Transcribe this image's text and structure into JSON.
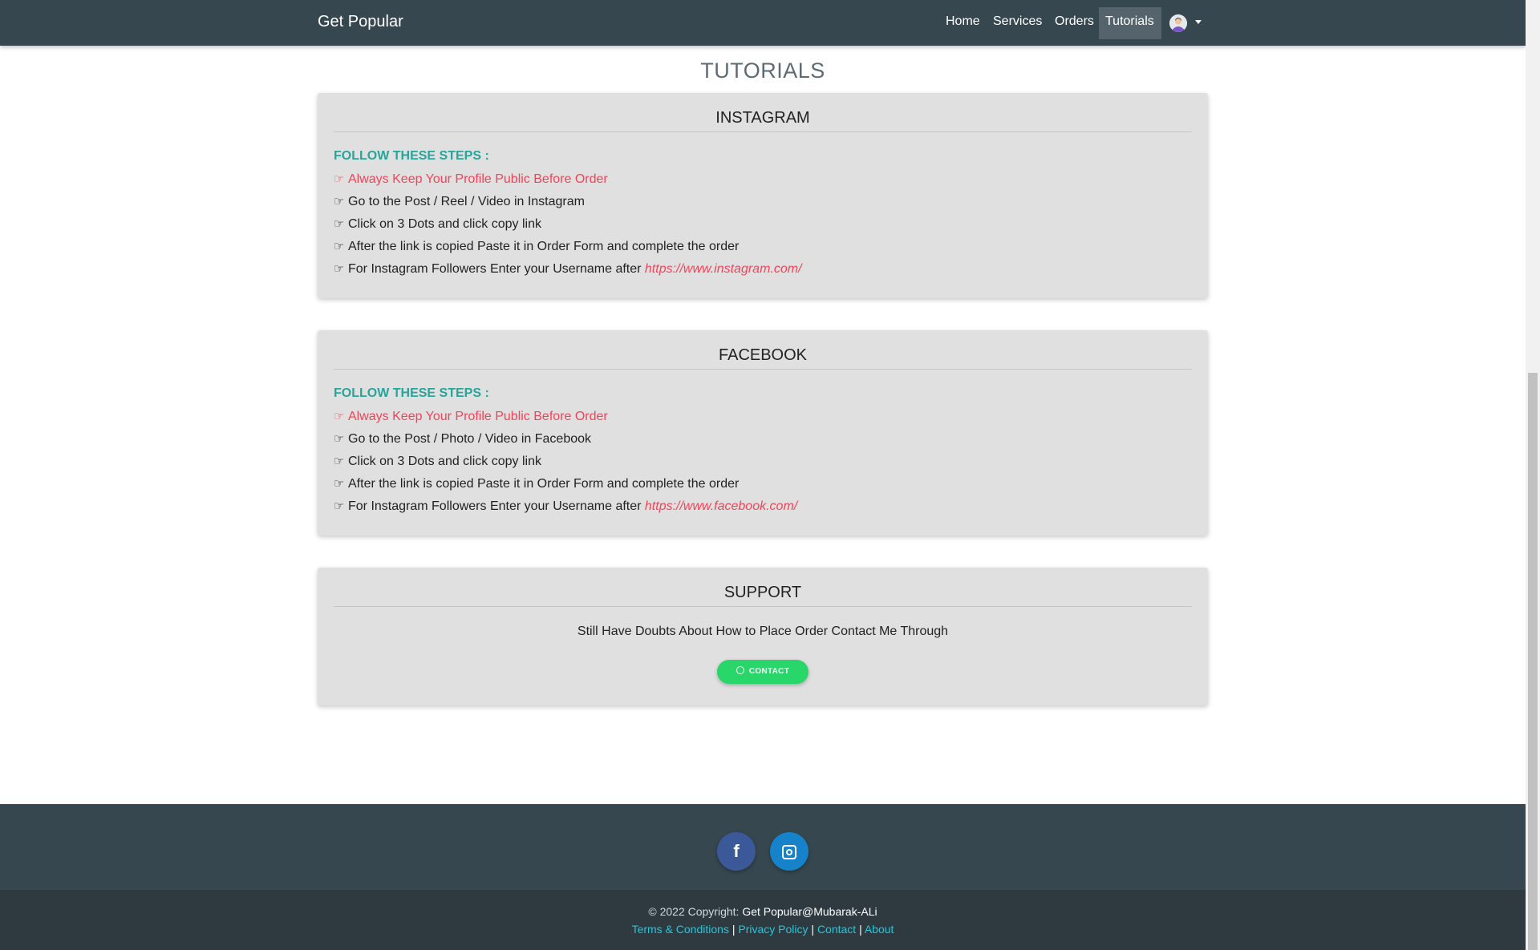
{
  "navbar": {
    "brand": "Get Popular",
    "links": [
      "Home",
      "Services",
      "Orders",
      "Tutorials"
    ],
    "active": "Tutorials"
  },
  "page": {
    "title": "TUTORIALS"
  },
  "instagram": {
    "title": "INSTAGRAM",
    "steps_label": "FOLLOW THESE STEPS :",
    "steps": [
      "Always Keep Your Profile Public Before Order",
      "Go to the Post / Reel / Video in Instagram",
      "Click on 3 Dots and click copy link",
      "After the link is copied Paste it in Order Form and complete the order",
      "For Instagram Followers Enter your Username after "
    ],
    "link": "https://www.instagram.com/"
  },
  "facebook": {
    "title": "FACEBOOK",
    "steps_label": "FOLLOW THESE STEPS :",
    "steps": [
      "Always Keep Your Profile Public Before Order",
      "Go to the Post / Photo / Video in Facebook",
      "Click on 3 Dots and click copy link",
      "After the link is copied Paste it in Order Form and complete the order",
      "For Instagram Followers Enter your Username after "
    ],
    "link": "https://www.facebook.com/"
  },
  "support": {
    "title": "SUPPORT",
    "text": "Still Have Doubts About How to Place Order Contact Me Through",
    "button": "CONTACT"
  },
  "footer": {
    "copyright": "© 2022 Copyright: ",
    "owner": "Get Popular@Mubarak-ALi",
    "links": [
      "Terms & Conditions",
      "Privacy Policy",
      "Contact",
      "About"
    ],
    "separator": " | "
  },
  "icons": {
    "hand": "hand-point-right-icon",
    "facebook": "facebook-icon",
    "instagram": "instagram-icon",
    "whatsapp": "whatsapp-icon"
  },
  "colors": {
    "navbar": "#37474f",
    "card": "#e0e0e0",
    "steps_label": "#26a69a",
    "warning": "#f44359",
    "contact_button": "#28d66a",
    "facebook": "#3b5998",
    "instagram": "#1582c9"
  }
}
